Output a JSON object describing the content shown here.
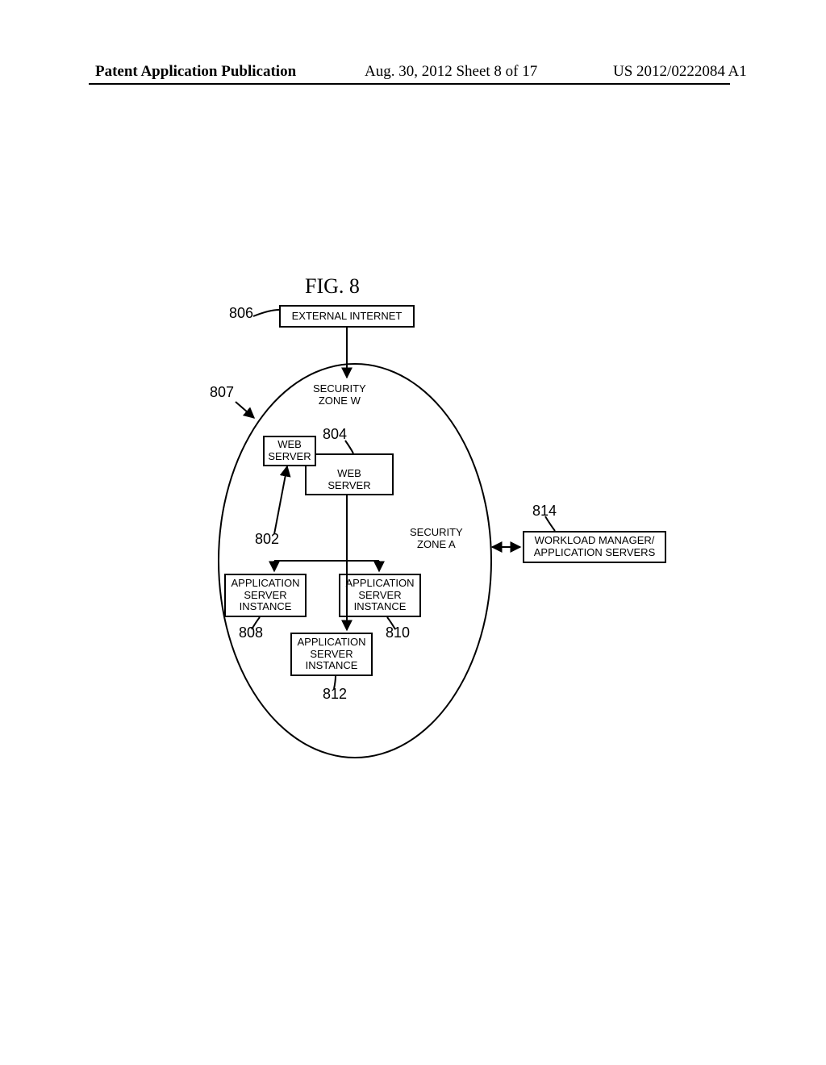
{
  "header": {
    "left": "Patent Application Publication",
    "mid": "Aug. 30, 2012  Sheet 8 of 17",
    "right": "US 2012/0222084 A1"
  },
  "figure": {
    "title": "FIG. 8",
    "labels": {
      "n806": "806",
      "n807": "807",
      "n804": "804",
      "n802": "802",
      "n808": "808",
      "n810": "810",
      "n812": "812",
      "n814": "814"
    },
    "boxes": {
      "ext_internet": "EXTERNAL INTERNET",
      "web_server_1": "WEB\nSERVER",
      "web_server_2": "WEB\nSERVER",
      "app_srv_1": "APPLICATION\nSERVER\nINSTANCE",
      "app_srv_2": "APPLICATION\nSERVER\nINSTANCE",
      "app_srv_3": "APPLICATION\nSERVER\nINSTANCE",
      "wlm": "WORKLOAD MANAGER/\nAPPLICATION SERVERS"
    },
    "zones": {
      "zone_w": "SECURITY\nZONE W",
      "zone_a": "SECURITY\nZONE A"
    }
  }
}
